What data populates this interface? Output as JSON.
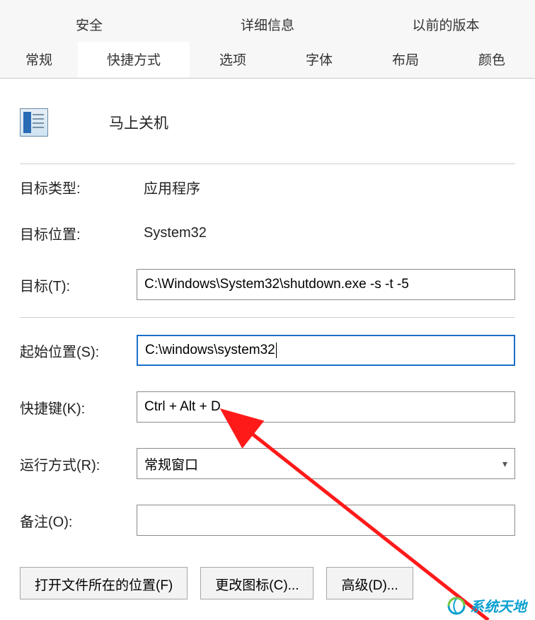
{
  "tabs": {
    "row1": [
      "安全",
      "详细信息",
      "以前的版本"
    ],
    "row2": [
      "常规",
      "快捷方式",
      "选项",
      "字体",
      "布局",
      "颜色"
    ],
    "active": "快捷方式"
  },
  "header": {
    "title": "马上关机"
  },
  "fields": {
    "target_type_label": "目标类型:",
    "target_type_value": "应用程序",
    "target_loc_label": "目标位置:",
    "target_loc_value": "System32",
    "target_label": "目标(T):",
    "target_value": "C:\\Windows\\System32\\shutdown.exe -s -t -5",
    "startin_label": "起始位置(S):",
    "startin_value": "C:\\windows\\system32",
    "hotkey_label": "快捷键(K):",
    "hotkey_value": "Ctrl + Alt + D",
    "run_label": "运行方式(R):",
    "run_value": "常规窗口",
    "comment_label": "备注(O):",
    "comment_value": ""
  },
  "buttons": {
    "open_location": "打开文件所在的位置(F)",
    "change_icon": "更改图标(C)...",
    "advanced": "高级(D)..."
  },
  "watermark": "系统天地"
}
